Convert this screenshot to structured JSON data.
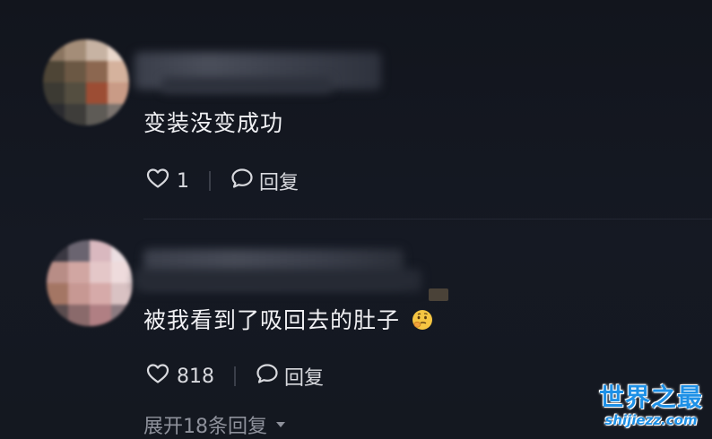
{
  "comments": [
    {
      "text": "变装没变成功",
      "likes": "1",
      "reply_label": "回复",
      "avatar_colors": [
        "#8a7560",
        "#a48d78",
        "#c7b3a3",
        "#ead8cc",
        "#4e4536",
        "#6b5844",
        "#8c6750",
        "#d5b29d",
        "#3c3a33",
        "#544e40",
        "#9c4d34",
        "#c99b86",
        "#2a2b2f",
        "#3e3d3a",
        "#5e5b56",
        "#7c746f"
      ]
    },
    {
      "text": "被我看到了吸回去的肚子",
      "likes": "818",
      "reply_label": "回复",
      "avatar_colors": [
        "#3a3842",
        "#6a6470",
        "#d9b8bf",
        "#ecdfe2",
        "#b88d86",
        "#d1a6a2",
        "#e4c7c8",
        "#eedbdc",
        "#a47664",
        "#c79893",
        "#d6aaa9",
        "#d9c2c3",
        "#5a4c4e",
        "#8a6a6b",
        "#b07f83",
        "#8b7a80"
      ]
    }
  ],
  "expand_replies": "展开18条回复",
  "watermark": {
    "title": "世界之最",
    "url": "shijiezz.com"
  },
  "colors": {
    "background": "#141720",
    "text": "#f0f0f3",
    "muted": "#8e919b",
    "watermark": "#1e90e6"
  }
}
